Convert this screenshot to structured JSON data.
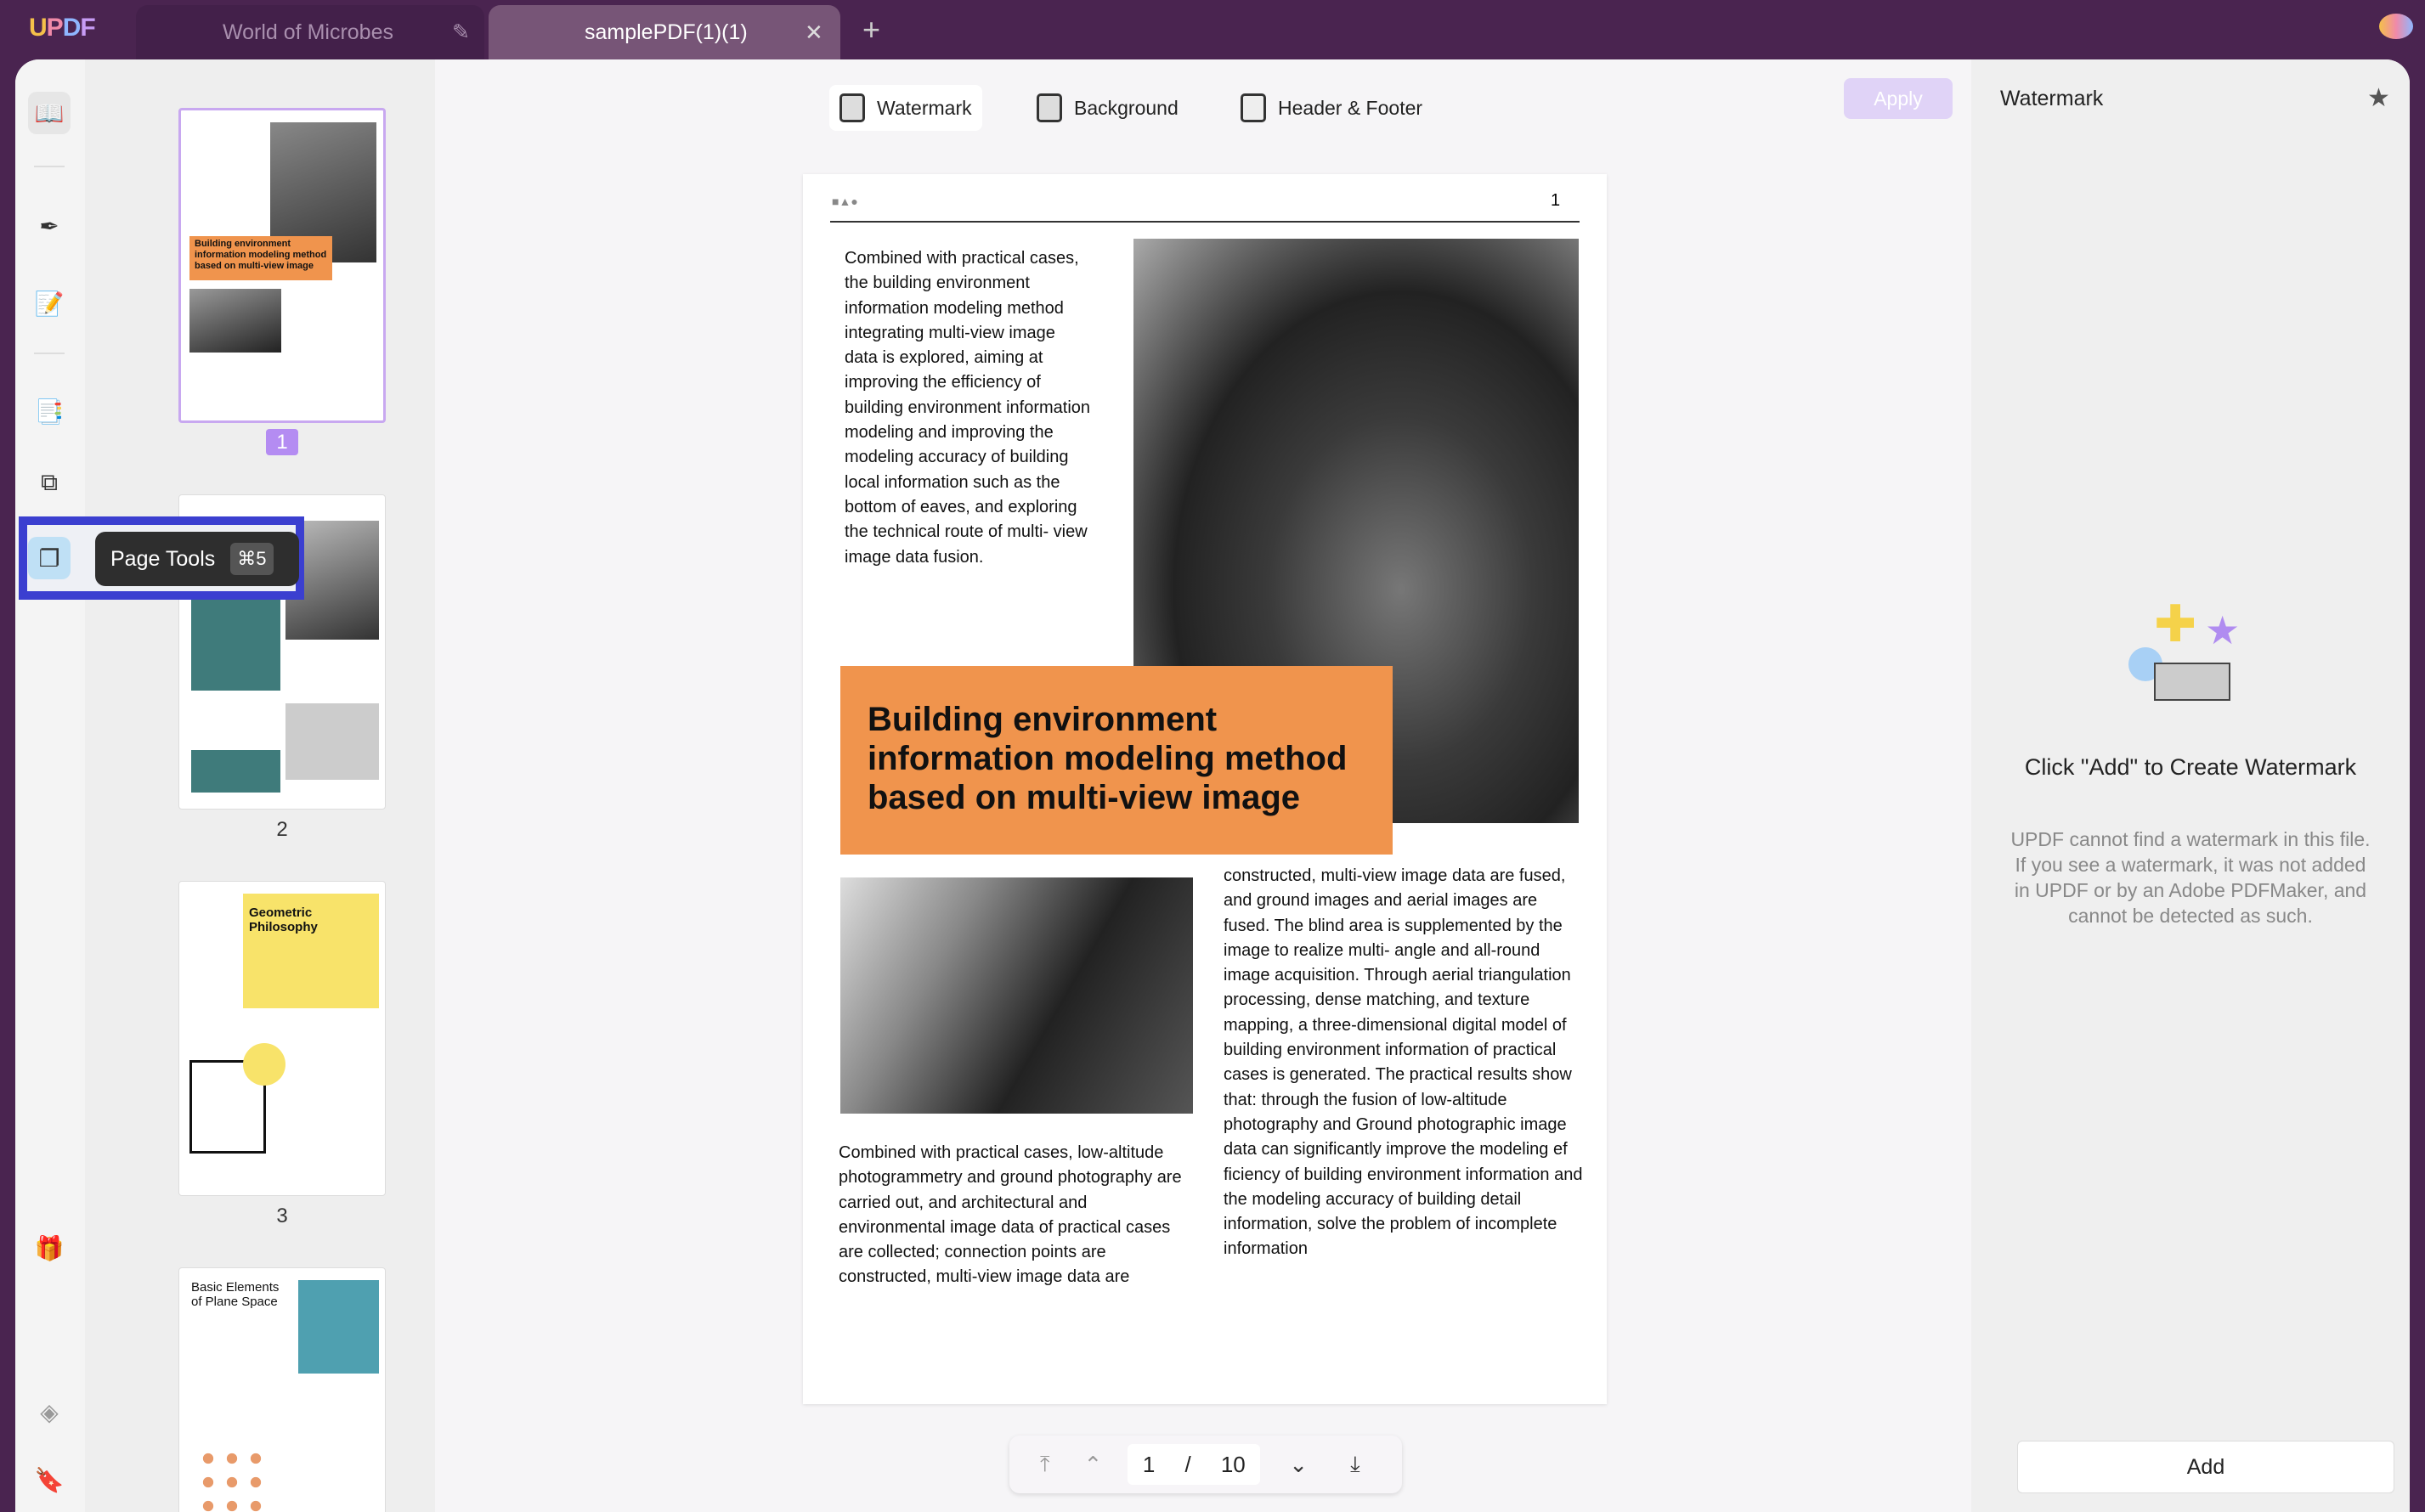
{
  "app": {
    "logo": "UPDF"
  },
  "tabs": [
    {
      "label": "World of Microbes",
      "icon": "pencil-icon"
    },
    {
      "label": "samplePDF(1)(1)",
      "icon": "close-icon"
    }
  ],
  "new_tab": "+",
  "tooltip": {
    "label": "Page Tools",
    "shortcut": "⌘5"
  },
  "toolbar": {
    "watermark": "Watermark",
    "background": "Background",
    "header_footer": "Header & Footer",
    "apply": "Apply"
  },
  "page": {
    "number": "1",
    "col1": "Combined with practical cases, the building environment information modeling method integrating multi-view image data is explored, aiming at improving the efficiency of building environment information modeling and improving the modeling accuracy of building local information such as the bottom of eaves, and exploring the technical route of multi- view image data fusion.",
    "headline": "Building environment information modeling method based on multi-view image",
    "col2": "constructed, multi-view image data are fused, and ground images and aerial images are fused. The blind area is supplemented by the image to realize multi- angle and all-round image acquisition. Through aerial triangulation processing, dense matching, and texture mapping, a three-dimensional digital model of building environment information of practical cases is generated. The practical results show that: through the fusion of low-altitude photography and Ground photographic image data can significantly improve the modeling ef ficiency of building environment information and the modeling accuracy of building detail information, solve the problem of incomplete information",
    "col3": "Combined with practical cases, low-altitude photogrammetry and ground photography are carried out, and architectural and environmental image data of practical cases are collected; connection points are constructed, multi-view image data are"
  },
  "thumbnails": [
    {
      "label": "1",
      "selected": true
    },
    {
      "label": "2"
    },
    {
      "label": "3"
    },
    {
      "label": "4"
    }
  ],
  "thumb_titles": {
    "t1": "Building environment information modeling method based on multi-view image",
    "t3": "Geometric Philosophy",
    "t4": "Basic Elements of Plane Space"
  },
  "nav": {
    "current": "1",
    "separator": "/",
    "total": "10"
  },
  "right_panel": {
    "title": "Watermark",
    "empty_title": "Click \"Add\" to Create Watermark",
    "empty_desc": "UPDF cannot find a watermark in this file. If you see a watermark, it was not added in UPDF or by an Adobe PDFMaker, and cannot be detected as such.",
    "add": "Add"
  },
  "colors": {
    "accent": "#4a2450",
    "headline_bg": "#f0944d",
    "apply_bg": "#e0d3f7",
    "highlight": "#3b3fd0"
  }
}
